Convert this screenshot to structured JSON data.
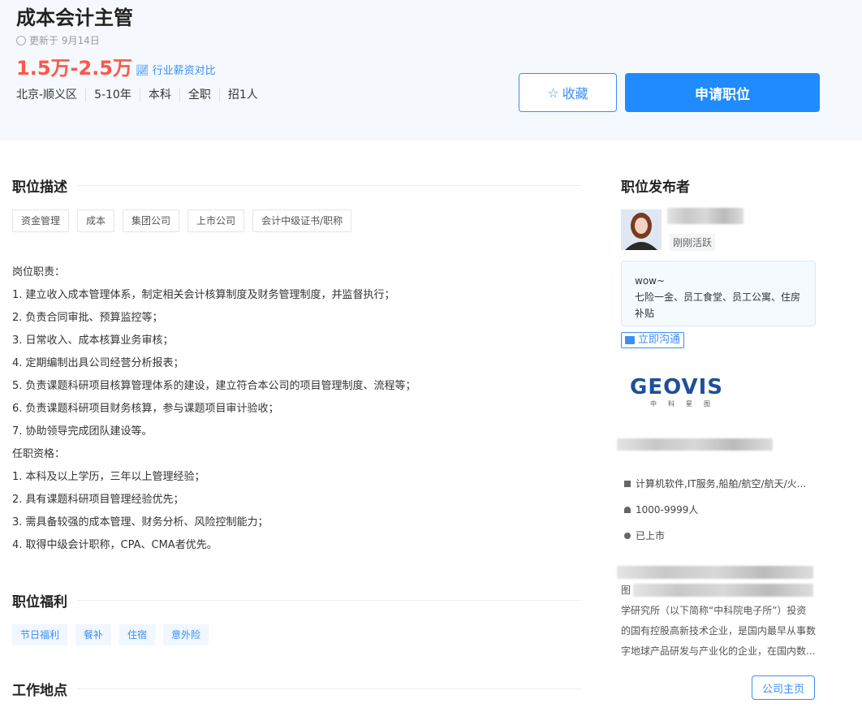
{
  "job": {
    "title": "成本会计主管",
    "updated": "更新于 9月14日",
    "salary": "1.5万-2.5万",
    "salary_compare": "行业薪资对比",
    "meta": [
      "北京-顺义区",
      "5-10年",
      "本科",
      "全职",
      "招1人"
    ],
    "favorite_label": "收藏",
    "apply_label": "申请职位"
  },
  "description": {
    "heading": "职位描述",
    "tags": [
      "资金管理",
      "成本",
      "集团公司",
      "上市公司",
      "会计中级证书/职称"
    ],
    "lines": [
      "岗位职责：",
      "1. 建立收入成本管理体系，制定相关会计核算制度及财务管理制度，并监督执行；",
      "2. 负责合同审批、预算监控等；",
      "3. 日常收入、成本核算业务审核；",
      "4. 定期编制出具公司经营分析报表；",
      "5. 负责课题科研项目核算管理体系的建设，建立符合本公司的项目管理制度、流程等；",
      "6. 负责课题科研项目财务核算，参与课题项目审计验收；",
      "7. 协助领导完成团队建设等。",
      "任职资格：",
      "1. 本科及以上学历，三年以上管理经验；",
      "2. 具有课题科研项目管理经验优先；",
      "3. 需具备较强的成本管理、财务分析、风险控制能力；",
      "4. 取得中级会计职称，CPA、CMA者优先。"
    ]
  },
  "welfare": {
    "heading": "职位福利",
    "tags": [
      "节日福利",
      "餐补",
      "住宿",
      "意外险"
    ]
  },
  "location": {
    "heading": "工作地点"
  },
  "publisher": {
    "heading": "职位发布者",
    "status": "刚刚活跃",
    "bubble_greeting": "wow~",
    "bubble_text": "七险一金、员工食堂、员工公寓、住房补贴",
    "chat_label": "立即沟通"
  },
  "company": {
    "logo_text": "GEOVIS",
    "logo_sub": "中科星图",
    "industry": "计算机软件,IT服务,船舶/航空/航天/火...",
    "size": "1000-9999人",
    "financing": "已上市",
    "intro_fragment": "图",
    "intro": "学研究所（以下简称“中科院电子所”）投资的国有控股高新技术企业，是国内最早从事数字地球产品研发与产业化的企业，在国内数...",
    "home_label": "公司主页"
  },
  "colors": {
    "accent": "#1f8bff",
    "salary": "#fe574a",
    "header_bg": "#f5f9fe"
  }
}
